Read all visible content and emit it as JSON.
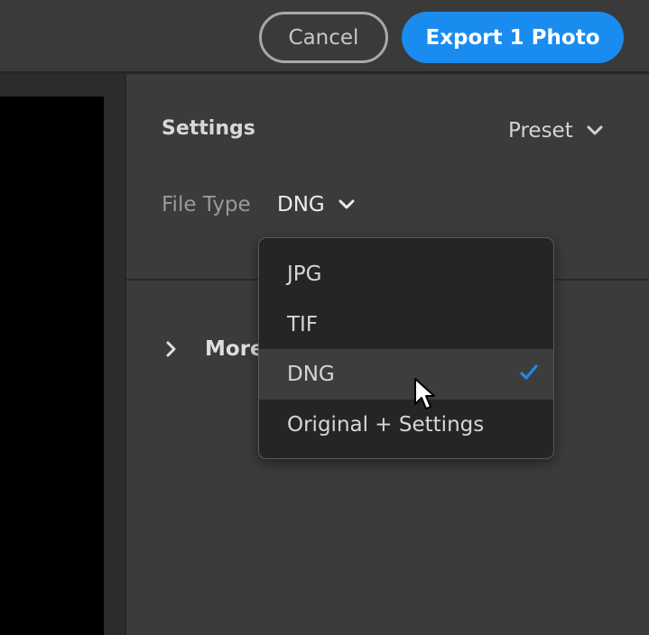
{
  "header": {
    "cancel_label": "Cancel",
    "export_label": "Export 1 Photo"
  },
  "settings": {
    "title": "Settings",
    "preset_label": "Preset",
    "file_type_label": "File Type",
    "file_type_value": "DNG"
  },
  "more": {
    "label": "More"
  },
  "dropdown": {
    "options": [
      "JPG",
      "TIF",
      "DNG",
      "Original + Settings"
    ],
    "selected": "DNG"
  },
  "colors": {
    "accent": "#1a8cf0",
    "check": "#1a8cf0"
  },
  "icons": {
    "preset": "chevron-down-icon",
    "file_type": "chevron-down-icon",
    "more": "chevron-right-icon",
    "selected": "checkmark-icon",
    "pointer": "mouse-cursor-icon"
  }
}
